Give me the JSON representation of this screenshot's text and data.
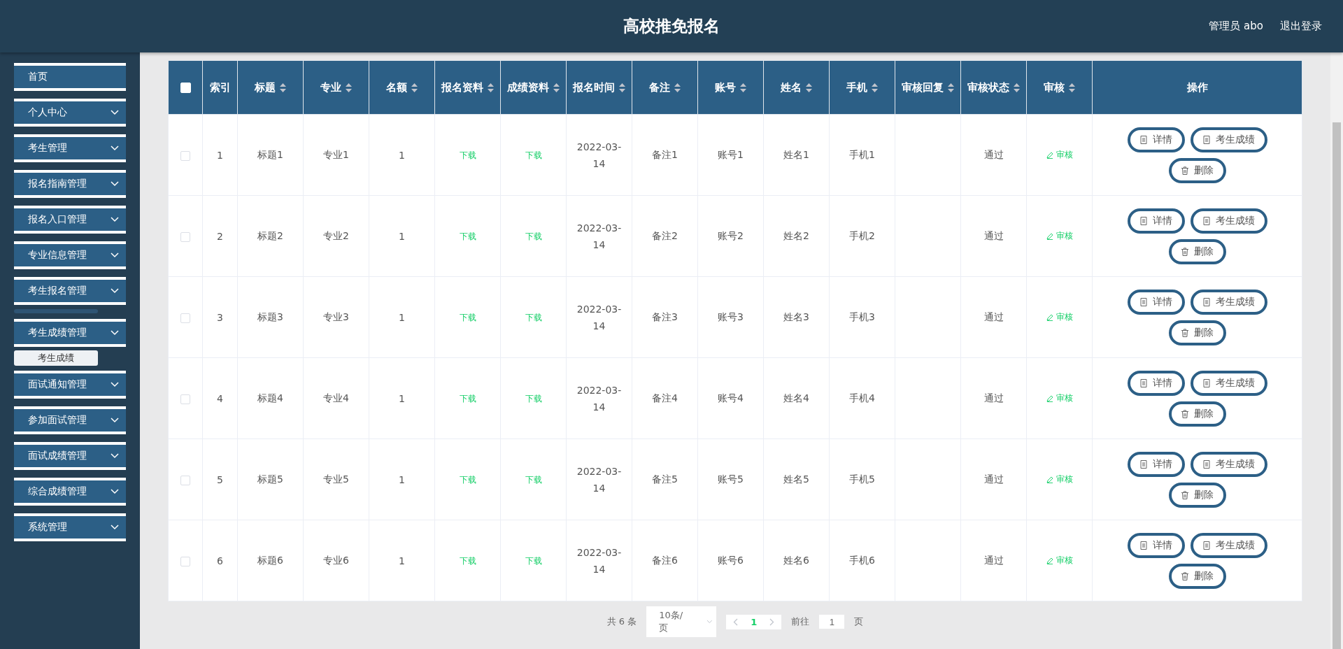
{
  "header": {
    "title": "高校推免报名",
    "user": "管理员 abo",
    "logout": "退出登录"
  },
  "sidebar": {
    "items": [
      {
        "label": "首页",
        "has_arrow": false
      },
      {
        "label": "个人中心",
        "has_arrow": true
      },
      {
        "label": "考生管理",
        "has_arrow": true
      },
      {
        "label": "报名指南管理",
        "has_arrow": true
      },
      {
        "label": "报名入口管理",
        "has_arrow": true
      },
      {
        "label": "专业信息管理",
        "has_arrow": true
      },
      {
        "label": "考生报名管理",
        "has_arrow": true,
        "collapsing": true
      },
      {
        "label": "考生成绩管理",
        "has_arrow": true,
        "children": [
          {
            "label": "考生成绩",
            "hovered": true
          }
        ]
      },
      {
        "label": "面试通知管理",
        "has_arrow": true
      },
      {
        "label": "参加面试管理",
        "has_arrow": true
      },
      {
        "label": "面试成绩管理",
        "has_arrow": true
      },
      {
        "label": "综合成绩管理",
        "has_arrow": true
      },
      {
        "label": "系统管理",
        "has_arrow": true
      }
    ]
  },
  "table": {
    "select_all_checked": false,
    "columns": [
      {
        "label": "索引",
        "sortable": false
      },
      {
        "label": "标题",
        "sortable": true
      },
      {
        "label": "专业",
        "sortable": true
      },
      {
        "label": "名额",
        "sortable": true
      },
      {
        "label": "报名资料",
        "sortable": true
      },
      {
        "label": "成绩资料",
        "sortable": true
      },
      {
        "label": "报名时间",
        "sortable": true
      },
      {
        "label": "备注",
        "sortable": true
      },
      {
        "label": "账号",
        "sortable": true
      },
      {
        "label": "姓名",
        "sortable": true
      },
      {
        "label": "手机",
        "sortable": true
      },
      {
        "label": "审核回复",
        "sortable": true
      },
      {
        "label": "审核状态",
        "sortable": true
      },
      {
        "label": "审核",
        "sortable": true
      },
      {
        "label": "操作",
        "sortable": false
      }
    ],
    "rows": [
      {
        "checked": false,
        "index": "1",
        "title": "标题1",
        "major": "专业1",
        "quota": "1",
        "apply_file": "下载",
        "score_file": "下载",
        "time": "2022-03-14",
        "note": "备注1",
        "account": "账号1",
        "name": "姓名1",
        "phone": "手机1",
        "status": "通过",
        "review": "审核",
        "actions": [
          "详情",
          "考生成绩",
          "删除"
        ]
      },
      {
        "checked": false,
        "index": "2",
        "title": "标题2",
        "major": "专业2",
        "quota": "1",
        "apply_file": "下载",
        "score_file": "下载",
        "time": "2022-03-14",
        "note": "备注2",
        "account": "账号2",
        "name": "姓名2",
        "phone": "手机2",
        "status": "通过",
        "review": "审核",
        "actions": [
          "详情",
          "考生成绩",
          "删除"
        ]
      },
      {
        "checked": false,
        "index": "3",
        "title": "标题3",
        "major": "专业3",
        "quota": "1",
        "apply_file": "下载",
        "score_file": "下载",
        "time": "2022-03-14",
        "note": "备注3",
        "account": "账号3",
        "name": "姓名3",
        "phone": "手机3",
        "status": "通过",
        "review": "审核",
        "actions": [
          "详情",
          "考生成绩",
          "删除"
        ]
      },
      {
        "checked": false,
        "index": "4",
        "title": "标题4",
        "major": "专业4",
        "quota": "1",
        "apply_file": "下载",
        "score_file": "下载",
        "time": "2022-03-14",
        "note": "备注4",
        "account": "账号4",
        "name": "姓名4",
        "phone": "手机4",
        "status": "通过",
        "review": "审核",
        "actions": [
          "详情",
          "考生成绩",
          "删除"
        ]
      },
      {
        "checked": false,
        "index": "5",
        "title": "标题5",
        "major": "专业5",
        "quota": "1",
        "apply_file": "下载",
        "score_file": "下载",
        "time": "2022-03-14",
        "note": "备注5",
        "account": "账号5",
        "name": "姓名5",
        "phone": "手机5",
        "status": "通过",
        "review": "审核",
        "actions": [
          "详情",
          "考生成绩",
          "删除"
        ]
      },
      {
        "checked": false,
        "index": "6",
        "title": "标题6",
        "major": "专业6",
        "quota": "1",
        "apply_file": "下载",
        "score_file": "下载",
        "time": "2022-03-14",
        "note": "备注6",
        "account": "账号6",
        "name": "姓名6",
        "phone": "手机6",
        "status": "通过",
        "review": "审核",
        "actions": [
          "详情",
          "考生成绩",
          "删除"
        ]
      }
    ]
  },
  "pagination": {
    "total": "共 6 条",
    "page_size": "10条/页",
    "current_page": "1",
    "goto_label": "前往",
    "goto_value": "1",
    "goto_unit": "页"
  }
}
